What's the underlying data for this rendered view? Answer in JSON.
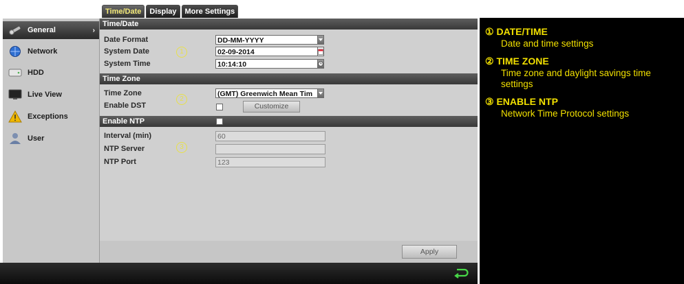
{
  "tabs": [
    {
      "label": "Time/Date",
      "active": true
    },
    {
      "label": "Display",
      "active": false
    },
    {
      "label": "More Settings",
      "active": false
    }
  ],
  "sidebar": {
    "items": [
      {
        "label": "General",
        "icon": "wrench-icon",
        "selected": true,
        "arrow": "›"
      },
      {
        "label": "Network",
        "icon": "globe-icon",
        "selected": false
      },
      {
        "label": "HDD",
        "icon": "hdd-icon",
        "selected": false
      },
      {
        "label": "Live View",
        "icon": "monitor-icon",
        "selected": false
      },
      {
        "label": "Exceptions",
        "icon": "warning-icon",
        "selected": false
      },
      {
        "label": "User",
        "icon": "user-icon",
        "selected": false
      }
    ]
  },
  "timedate": {
    "section": "Time/Date",
    "date_format_label": "Date Format",
    "date_format_value": "DD-MM-YYYY",
    "system_date_label": "System Date",
    "system_date_value": "02-09-2014",
    "system_time_label": "System Time",
    "system_time_value": "10:14:10"
  },
  "timezone": {
    "section": "Time Zone",
    "label": "Time Zone",
    "value": "(GMT) Greenwich Mean Tim",
    "dst_label": "Enable DST",
    "dst_checked": false,
    "customize_label": "Customize"
  },
  "ntp": {
    "section": "Enable NTP",
    "checked": false,
    "interval_label": "Interval (min)",
    "interval_value": "60",
    "server_label": "NTP Server",
    "server_value": "",
    "port_label": "NTP Port",
    "port_value": "123"
  },
  "markers": [
    "1",
    "2",
    "3"
  ],
  "apply_label": "Apply",
  "status": {
    "back_icon": "return-icon"
  },
  "legend": [
    {
      "num": "①",
      "title": "DATE/TIME",
      "desc": "Date and time settings"
    },
    {
      "num": "②",
      "title": "TIME ZONE",
      "desc": "Time zone and daylight savings time settings"
    },
    {
      "num": "③",
      "title": "ENABLE NTP",
      "desc": "Network Time Protocol settings"
    }
  ],
  "colors": {
    "accent_yellow": "#f2e000",
    "marker_yellow": "#e8e04a",
    "header_dark": "#383838"
  }
}
